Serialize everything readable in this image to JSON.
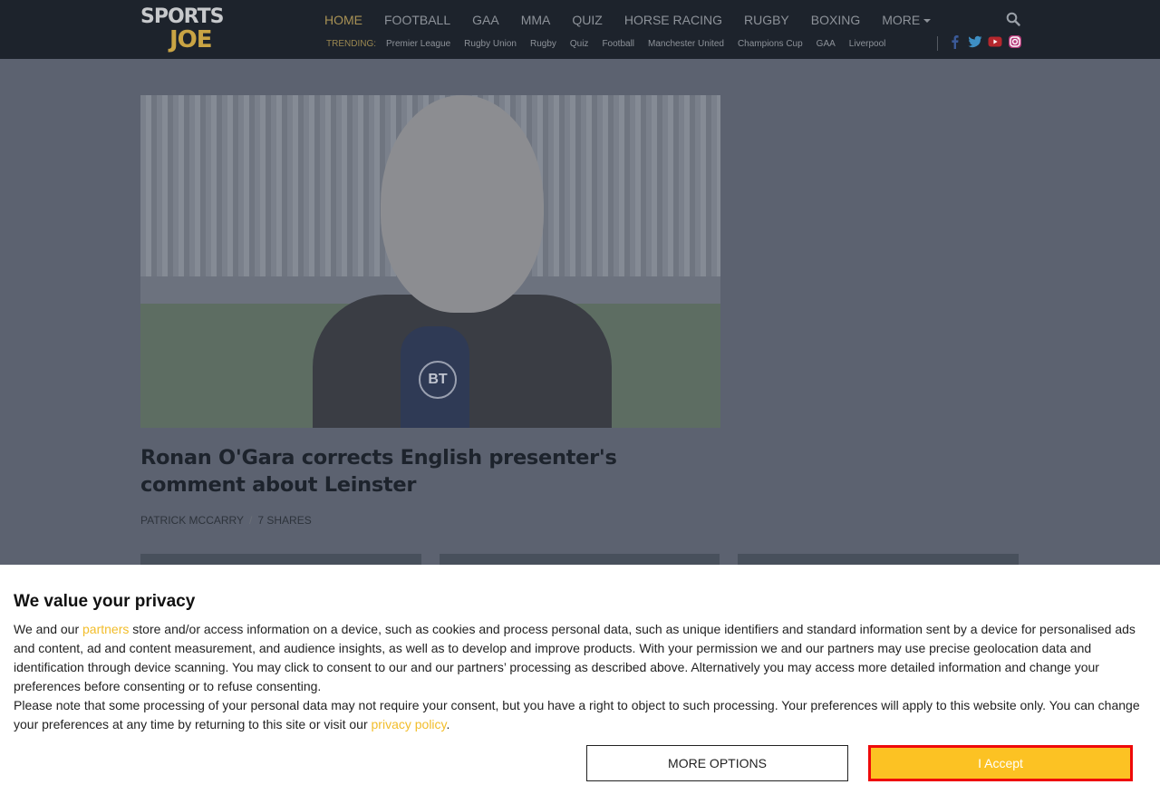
{
  "header": {
    "logo_top": "SPORTS",
    "logo_bottom": "JOE",
    "nav": [
      "HOME",
      "FOOTBALL",
      "GAA",
      "MMA",
      "QUIZ",
      "HORSE RACING",
      "RUGBY",
      "BOXING",
      "MORE"
    ],
    "trending_label": "TRENDING:",
    "trending": [
      "Premier League",
      "Rugby Union",
      "Rugby",
      "Quiz",
      "Football",
      "Manchester United",
      "Champions Cup",
      "GAA",
      "Liverpool"
    ]
  },
  "article": {
    "headline": "Ronan O'Gara corrects English presenter's comment about Leinster",
    "author": "PATRICK MCCARRY",
    "separator": "/",
    "shares": "7 SHARES",
    "mic_label": "BT"
  },
  "consent": {
    "title": "We value your privacy",
    "p1_before": "We and our ",
    "p1_link": "partners",
    "p1_after": " store and/or access information on a device, such as cookies and process personal data, such as unique identifiers and standard information sent by a device for personalised ads and content, ad and content measurement, and audience insights, as well as to develop and improve products. With your permission we and our partners may use precise geolocation data and identification through device scanning. You may click to consent to our and our partners’ processing as described above. Alternatively you may access more detailed information and change your preferences before consenting or to refuse consenting.",
    "p2_before": "Please note that some processing of your personal data may not require your consent, but you have a right to object to such processing. Your preferences will apply to this website only. You can change your preferences at any time by returning to this site or visit our ",
    "p2_link": "privacy policy",
    "p2_after": ".",
    "more_options": "MORE OPTIONS",
    "accept": "I Accept"
  },
  "colors": {
    "header_bg": "#1d232c",
    "accent_gold": "#c9a444",
    "link_yellow": "#f2bd2a",
    "accept_bg": "#fcc223",
    "accept_border": "#ee0a0a"
  }
}
